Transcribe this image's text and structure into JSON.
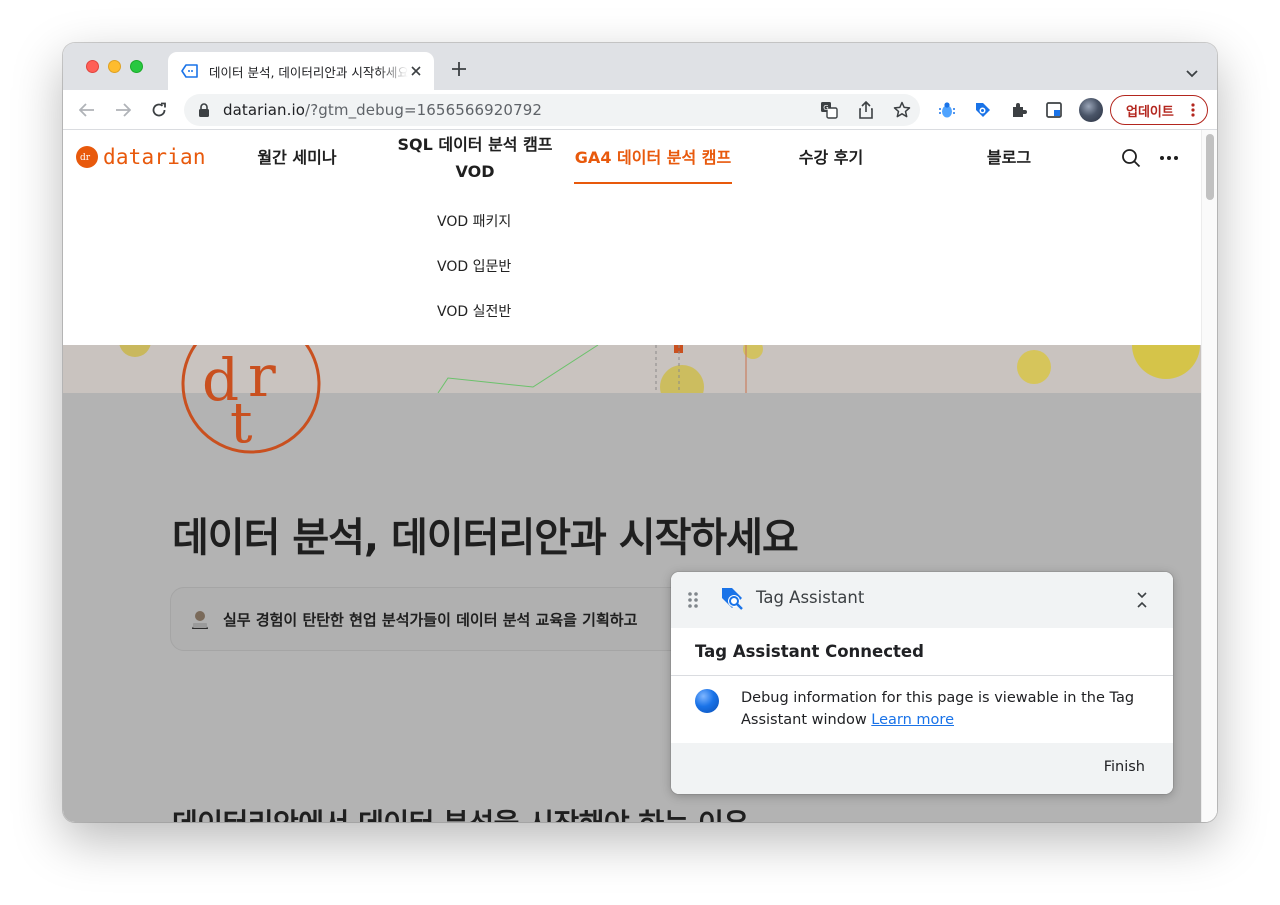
{
  "browser": {
    "tab_title": "데이터 분석, 데이터리안과 시작하세요",
    "url_host": "datarian.io",
    "url_path": "/?gtm_debug=1656566920792",
    "update_label": "업데이트"
  },
  "site": {
    "logo_text": "datarian",
    "nav": [
      {
        "label": "월간 세미나"
      },
      {
        "label_line1": "SQL 데이터 분석 캠프",
        "label_line2": "VOD"
      },
      {
        "label": "GA4 데이터 분석 캠프"
      },
      {
        "label": "수강 후기"
      },
      {
        "label": "블로그"
      }
    ],
    "submenu": [
      "VOD 패키지",
      "VOD 입문반",
      "VOD 실전반"
    ],
    "headline": "데이터 분석, 데이터리안과 시작하세요",
    "pill_text": "실무 경험이 탄탄한 현업 분석가들이 데이터 분석 교육을 기획하고",
    "sub_headline": "데이터리안에서 데이터 분석을 시작해야 하는 이유"
  },
  "tag_assistant": {
    "title": "Tag Assistant",
    "connected": "Tag Assistant Connected",
    "message": "Debug information for this page is viewable in the Tag Assistant window",
    "link": "Learn more",
    "finish": "Finish"
  },
  "colors": {
    "brand_orange": "#e8590c",
    "update_red": "#b3261e",
    "link_blue": "#1a73e8"
  }
}
